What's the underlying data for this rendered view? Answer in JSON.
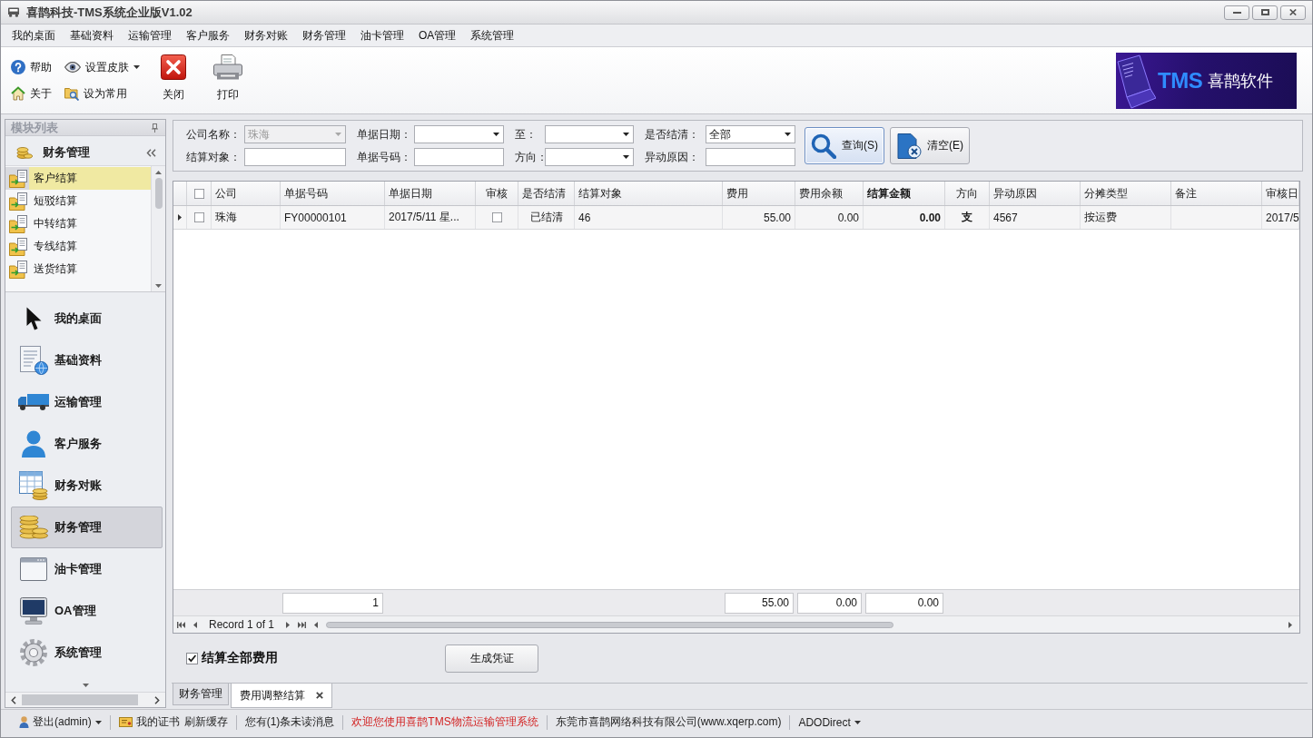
{
  "window": {
    "title": "喜鹊科技-TMS系统企业版V1.02"
  },
  "menu": [
    "我的桌面",
    "基础资料",
    "运输管理",
    "客户服务",
    "财务对账",
    "财务管理",
    "油卡管理",
    "OA管理",
    "系统管理"
  ],
  "toolbar": {
    "small_buttons": [
      {
        "label": "帮助",
        "dropdown": false
      },
      {
        "label": "设置皮肤",
        "dropdown": true
      },
      {
        "label": "关于",
        "dropdown": false
      },
      {
        "label": "设为常用",
        "dropdown": false
      }
    ],
    "large_buttons": [
      "关闭",
      "打印"
    ],
    "logo": {
      "brand": "TMS",
      "name": "喜鹊软件"
    }
  },
  "sidebar": {
    "title": "模块列表",
    "group": {
      "title": "财务管理",
      "items": [
        {
          "label": "客户结算",
          "selected": true
        },
        {
          "label": "短驳结算",
          "selected": false
        },
        {
          "label": "中转结算",
          "selected": false
        },
        {
          "label": "专线结算",
          "selected": false
        },
        {
          "label": "送货结算",
          "selected": false
        }
      ]
    },
    "modules": [
      {
        "label": "我的桌面",
        "selected": false
      },
      {
        "label": "基础资料",
        "selected": false
      },
      {
        "label": "运输管理",
        "selected": false
      },
      {
        "label": "客户服务",
        "selected": false
      },
      {
        "label": "财务对账",
        "selected": false
      },
      {
        "label": "财务管理",
        "selected": true
      },
      {
        "label": "油卡管理",
        "selected": false
      },
      {
        "label": "OA管理",
        "selected": false
      },
      {
        "label": "系统管理",
        "selected": false
      }
    ]
  },
  "filters": [
    {
      "label": "公司名称：",
      "kind": "combo",
      "value": "珠海",
      "disabled": true
    },
    {
      "label": "单据日期：",
      "kind": "combo",
      "disabled": false
    },
    {
      "label": "至：",
      "kind": "combo",
      "disabled": false
    },
    {
      "label": "是否结清：",
      "kind": "combo",
      "value": "全部",
      "disabled": false
    },
    {
      "label": "结算对象：",
      "kind": "input",
      "disabled": false
    },
    {
      "label": "单据号码：",
      "kind": "input",
      "disabled": false
    },
    {
      "label": "方向：",
      "kind": "combo",
      "disabled": false
    },
    {
      "label": "异动原因：",
      "kind": "input",
      "disabled": false
    }
  ],
  "filter_buttons": [
    {
      "label": "查询(S)",
      "focused": true
    },
    {
      "label": "清空(E)",
      "focused": false
    }
  ],
  "table": {
    "select_all_checked": false,
    "columns": [
      {
        "label": "公司",
        "kind": "text"
      },
      {
        "label": "单据号码",
        "kind": "text",
        "total": "1"
      },
      {
        "label": "单据日期",
        "kind": "text"
      },
      {
        "label": "审核",
        "kind": "check"
      },
      {
        "label": "是否结清",
        "kind": "status"
      },
      {
        "label": "结算对象",
        "kind": "text"
      },
      {
        "label": "费用",
        "kind": "amount",
        "total": "55.00"
      },
      {
        "label": "费用余额",
        "kind": "amount",
        "total": "0.00"
      },
      {
        "label": "结算金额",
        "kind": "total",
        "total": "0.00"
      },
      {
        "label": "方向",
        "kind": "flag"
      },
      {
        "label": "异动原因",
        "kind": "text"
      },
      {
        "label": "分摊类型",
        "kind": "text"
      },
      {
        "label": "备注",
        "kind": "text"
      },
      {
        "label": "审核日",
        "kind": "text"
      }
    ],
    "rows": [
      {
        "current": true,
        "checked": false,
        "cells": [
          "珠海",
          "FY00000101",
          "2017/5/11 星...",
          false,
          "已结清",
          "46",
          "55.00",
          "0.00",
          "0.00",
          "支",
          "4567",
          "按运费",
          null,
          "2017/5"
        ]
      }
    ],
    "navigator": "Record 1 of 1"
  },
  "footer": {
    "settle_all": {
      "label": "结算全部费用",
      "checked": true
    },
    "button": "生成凭证"
  },
  "tabs": [
    {
      "label": "财务管理",
      "selected": false,
      "closable": false
    },
    {
      "label": "费用调整结算",
      "selected": true,
      "closable": true
    }
  ],
  "status_bar": {
    "groups": [
      {
        "items": [
          {
            "label": "登出(admin)",
            "kind": "account"
          }
        ]
      },
      {
        "items": [
          {
            "label": "我的证书",
            "kind": "certificate"
          },
          {
            "label": "刷新缓存",
            "kind": "plain"
          }
        ]
      },
      {
        "items": [
          {
            "label": "您有(1)条未读消息",
            "kind": "plain"
          }
        ]
      },
      {
        "items": [
          {
            "label": "欢迎您使用喜鹊TMS物流运输管理系统",
            "kind": "notice"
          }
        ]
      },
      {
        "items": [
          {
            "label": "东莞市喜鹊网络科技有限公司(www.xqerp.com)",
            "kind": "plain"
          }
        ]
      },
      {
        "items": [
          {
            "label": "ADODirect",
            "kind": "dropdown"
          }
        ]
      }
    ]
  }
}
